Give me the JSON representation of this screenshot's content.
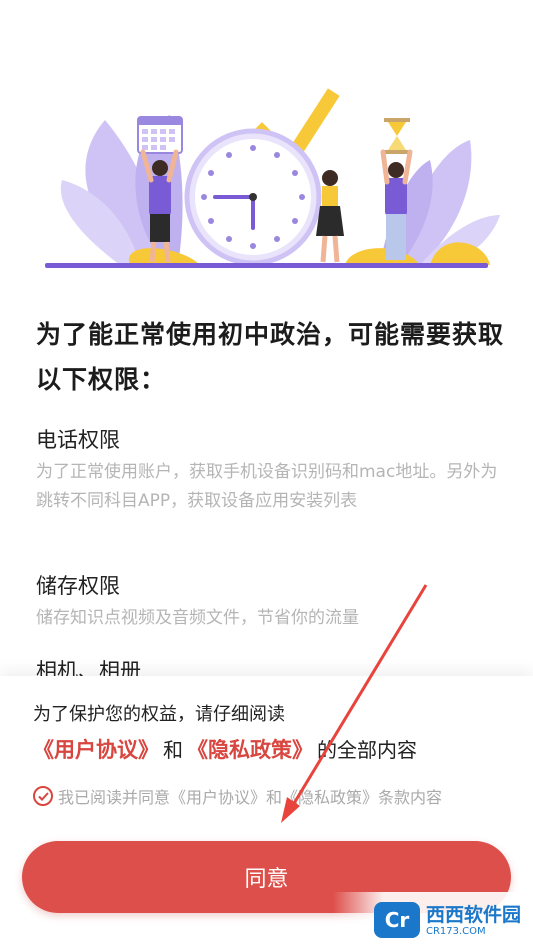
{
  "permissions_page": {
    "title": "为了能正常使用初中政治，可能需要获取以下权限：",
    "permissions": [
      {
        "title": "电话权限",
        "description": "为了正常使用账户，获取手机设备识别码和mac地址。另外为跳转不同科目APP，获取设备应用安装列表"
      },
      {
        "title": "储存权限",
        "description": "储存知识点视频及音频文件，节省你的流量"
      },
      {
        "title": "相机、相册",
        "description": ""
      }
    ]
  },
  "privacy_sheet": {
    "notice": "为了保护您的权益，请仔细阅读",
    "user_agreement_link": "《用户协议》",
    "and": "和",
    "privacy_policy_link": "《隐私政策》",
    "suffix": "的全部内容",
    "consent_text": "我已阅读并同意《用户协议》和《隐私政策》条款内容",
    "agree_button": "同意"
  },
  "watermark": {
    "logo": "Cr",
    "text": "西西软件园",
    "url": "CR173.COM"
  },
  "colors": {
    "accent": "#dd4f4a",
    "link": "#d8463f",
    "illustration_purple": "#7a5bd6",
    "illustration_light_purple": "#cfc3f5",
    "illustration_yellow": "#f7c938"
  }
}
